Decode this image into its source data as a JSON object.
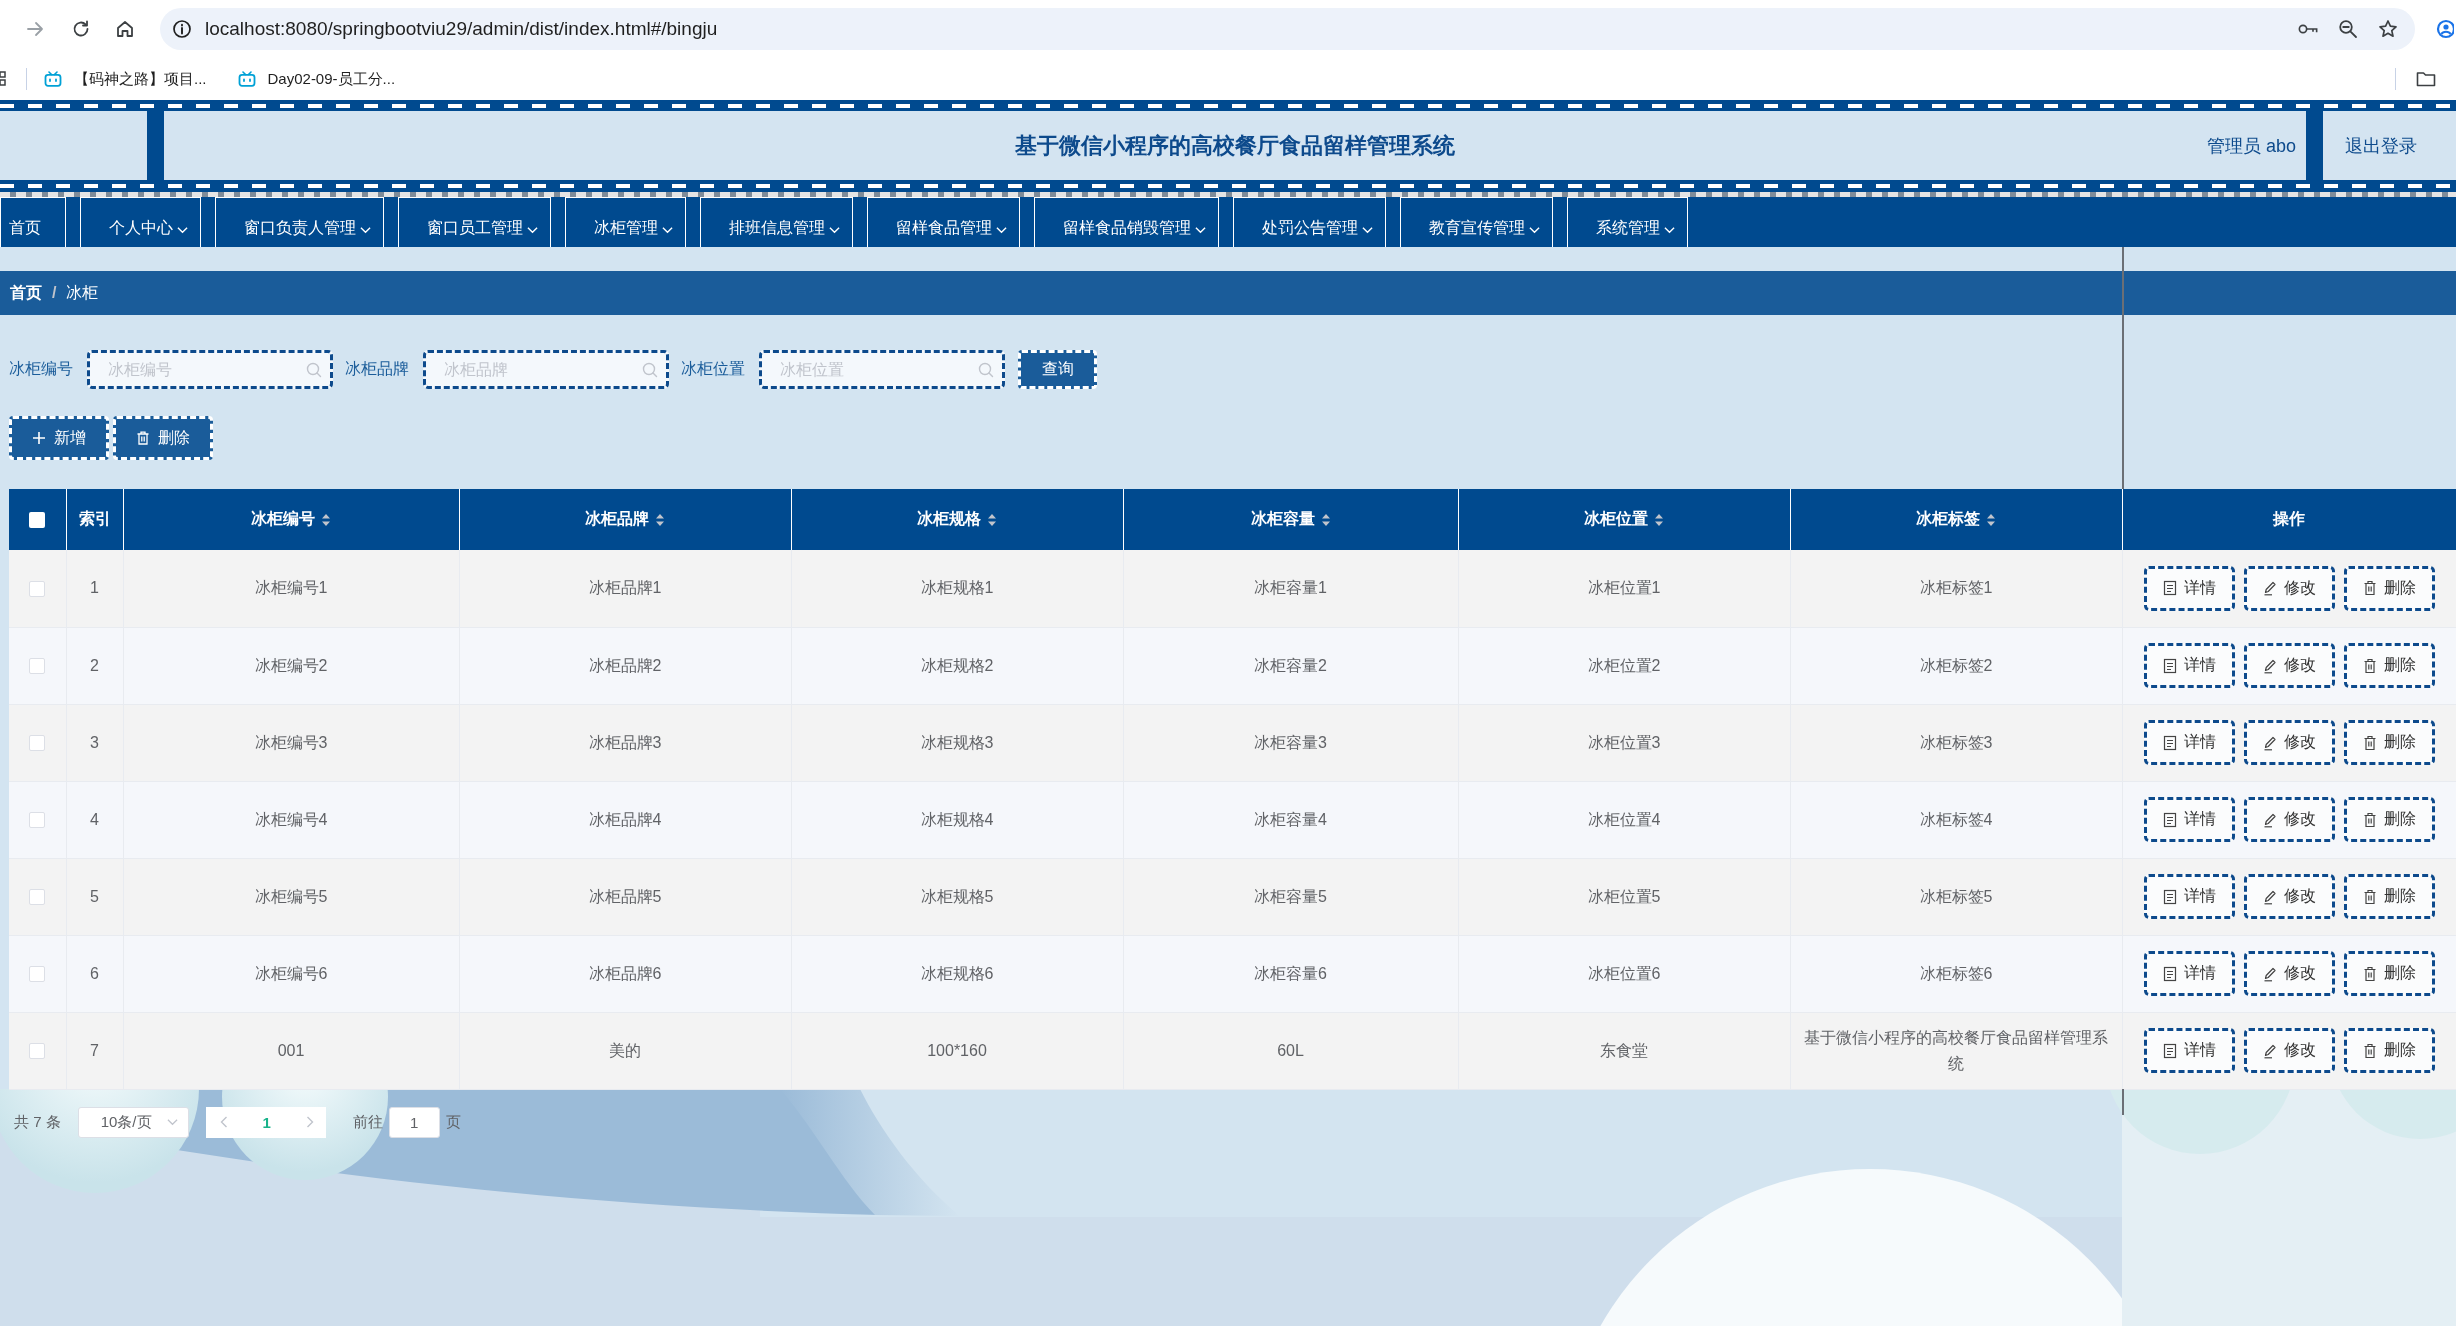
{
  "browser": {
    "url": "localhost:8080/springbootviu29/admin/dist/index.html#/bingju",
    "bookmarks": [
      {
        "label": "【码神之路】项目..."
      },
      {
        "label": "Day02-09-员工分..."
      }
    ]
  },
  "header": {
    "title": "基于微信小程序的高校餐厅食品留样管理系统",
    "user": "管理员 abo",
    "logout": "退出登录"
  },
  "nav": [
    {
      "label": "首页",
      "dropdown": false
    },
    {
      "label": "个人中心",
      "dropdown": true
    },
    {
      "label": "窗口负责人管理",
      "dropdown": true
    },
    {
      "label": "窗口员工管理",
      "dropdown": true
    },
    {
      "label": "冰柜管理",
      "dropdown": true
    },
    {
      "label": "排班信息管理",
      "dropdown": true
    },
    {
      "label": "留样食品管理",
      "dropdown": true
    },
    {
      "label": "留样食品销毁管理",
      "dropdown": true
    },
    {
      "label": "处罚公告管理",
      "dropdown": true
    },
    {
      "label": "教育宣传管理",
      "dropdown": true
    },
    {
      "label": "系统管理",
      "dropdown": true
    }
  ],
  "breadcrumb": {
    "separator": "/",
    "items": [
      {
        "label": "首页",
        "current": false
      },
      {
        "label": "冰柜",
        "current": true
      }
    ]
  },
  "search": {
    "fields": [
      {
        "label": "冰柜编号",
        "placeholder": "冰柜编号"
      },
      {
        "label": "冰柜品牌",
        "placeholder": "冰柜品牌"
      },
      {
        "label": "冰柜位置",
        "placeholder": "冰柜位置"
      }
    ],
    "button": "查询"
  },
  "actions": [
    {
      "kind": "add",
      "label": "新增"
    },
    {
      "kind": "delete",
      "label": "删除"
    }
  ],
  "table": {
    "select_all": {
      "checked": false
    },
    "columns": [
      {
        "label": "索引",
        "sortable": false
      },
      {
        "label": "冰柜编号",
        "sortable": true
      },
      {
        "label": "冰柜品牌",
        "sortable": true
      },
      {
        "label": "冰柜规格",
        "sortable": true
      },
      {
        "label": "冰柜容量",
        "sortable": true
      },
      {
        "label": "冰柜位置",
        "sortable": true
      },
      {
        "label": "冰柜标签",
        "sortable": true
      },
      {
        "label": "操作",
        "sortable": false
      }
    ],
    "rows": [
      {
        "checked": false,
        "cells": [
          "1",
          "冰柜编号1",
          "冰柜品牌1",
          "冰柜规格1",
          "冰柜容量1",
          "冰柜位置1",
          "冰柜标签1"
        ],
        "operations": [
          {
            "kind": "detail",
            "label": "详情"
          },
          {
            "kind": "edit",
            "label": "修改"
          },
          {
            "kind": "delete",
            "label": "删除"
          }
        ]
      },
      {
        "checked": false,
        "cells": [
          "2",
          "冰柜编号2",
          "冰柜品牌2",
          "冰柜规格2",
          "冰柜容量2",
          "冰柜位置2",
          "冰柜标签2"
        ],
        "operations": [
          {
            "kind": "detail",
            "label": "详情"
          },
          {
            "kind": "edit",
            "label": "修改"
          },
          {
            "kind": "delete",
            "label": "删除"
          }
        ]
      },
      {
        "checked": false,
        "cells": [
          "3",
          "冰柜编号3",
          "冰柜品牌3",
          "冰柜规格3",
          "冰柜容量3",
          "冰柜位置3",
          "冰柜标签3"
        ],
        "operations": [
          {
            "kind": "detail",
            "label": "详情"
          },
          {
            "kind": "edit",
            "label": "修改"
          },
          {
            "kind": "delete",
            "label": "删除"
          }
        ]
      },
      {
        "checked": false,
        "cells": [
          "4",
          "冰柜编号4",
          "冰柜品牌4",
          "冰柜规格4",
          "冰柜容量4",
          "冰柜位置4",
          "冰柜标签4"
        ],
        "operations": [
          {
            "kind": "detail",
            "label": "详情"
          },
          {
            "kind": "edit",
            "label": "修改"
          },
          {
            "kind": "delete",
            "label": "删除"
          }
        ]
      },
      {
        "checked": false,
        "cells": [
          "5",
          "冰柜编号5",
          "冰柜品牌5",
          "冰柜规格5",
          "冰柜容量5",
          "冰柜位置5",
          "冰柜标签5"
        ],
        "operations": [
          {
            "kind": "detail",
            "label": "详情"
          },
          {
            "kind": "edit",
            "label": "修改"
          },
          {
            "kind": "delete",
            "label": "删除"
          }
        ]
      },
      {
        "checked": false,
        "cells": [
          "6",
          "冰柜编号6",
          "冰柜品牌6",
          "冰柜规格6",
          "冰柜容量6",
          "冰柜位置6",
          "冰柜标签6"
        ],
        "operations": [
          {
            "kind": "detail",
            "label": "详情"
          },
          {
            "kind": "edit",
            "label": "修改"
          },
          {
            "kind": "delete",
            "label": "删除"
          }
        ]
      },
      {
        "checked": false,
        "cells": [
          "7",
          "001",
          "美的",
          "100*160",
          "60L",
          "东食堂",
          "基于微信小程序的高校餐厅食品留样管理系统"
        ],
        "operations": [
          {
            "kind": "detail",
            "label": "详情"
          },
          {
            "kind": "edit",
            "label": "修改"
          },
          {
            "kind": "delete",
            "label": "删除"
          }
        ]
      }
    ]
  },
  "pagination": {
    "total": "共 7 条",
    "page_size": "10条/页",
    "pages": [
      {
        "label": "1",
        "selected": true
      }
    ],
    "jump_label": "前往",
    "jump_value": "1",
    "jump_suffix": "页"
  }
}
